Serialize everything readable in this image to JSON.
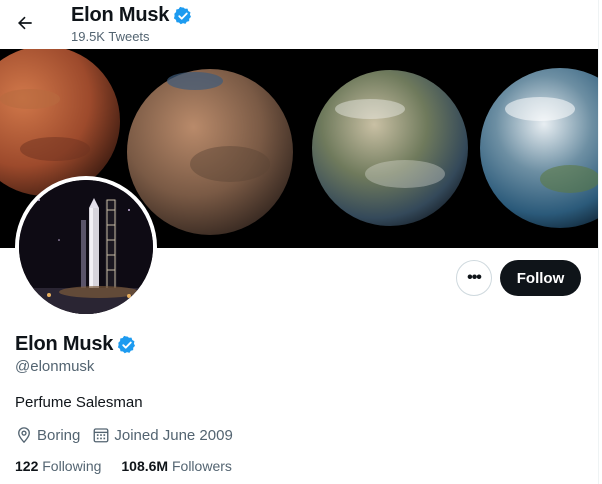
{
  "header": {
    "back_icon": "arrow-left-icon",
    "name": "Elon Musk",
    "tweet_count": "19.5K Tweets",
    "verified_icon": "verified-badge-icon"
  },
  "banner": {
    "description_icon": "planet-terraforming-banner"
  },
  "actions": {
    "more_label": "•••",
    "follow_label": "Follow"
  },
  "profile": {
    "name": "Elon Musk",
    "handle": "@elonmusk",
    "bio": "Perfume Salesman",
    "location": "Boring",
    "joined": "Joined June 2009",
    "following_count": "122",
    "following_label": "Following",
    "followers_count": "108.6M",
    "followers_label": "Followers"
  },
  "colors": {
    "verified": "#1d9bf0",
    "text_primary": "#0f1419",
    "text_secondary": "#536471",
    "follow_bg": "#0f1419"
  }
}
